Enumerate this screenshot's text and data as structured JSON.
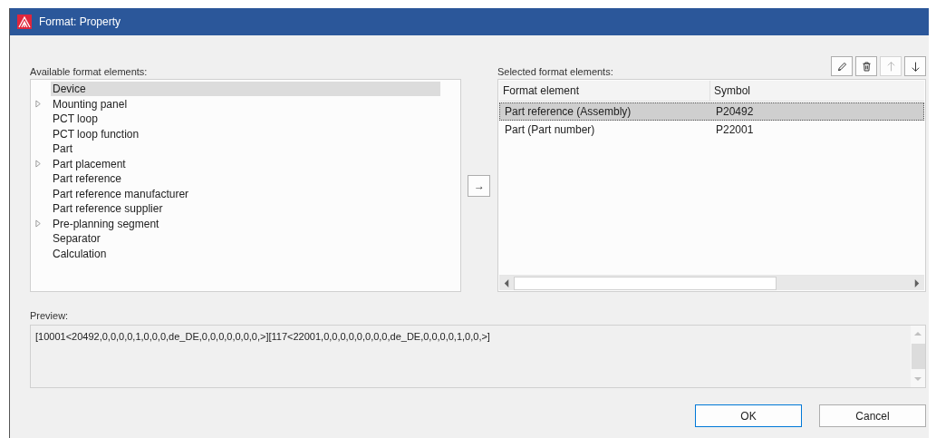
{
  "window": {
    "title": "Format: Property"
  },
  "available": {
    "label": "Available format elements:",
    "items": [
      {
        "label": "Device",
        "expandable": false,
        "selected": true
      },
      {
        "label": "Mounting panel",
        "expandable": true,
        "selected": false
      },
      {
        "label": "PCT loop",
        "expandable": false,
        "selected": false
      },
      {
        "label": "PCT loop function",
        "expandable": false,
        "selected": false
      },
      {
        "label": "Part",
        "expandable": false,
        "selected": false
      },
      {
        "label": "Part placement",
        "expandable": true,
        "selected": false
      },
      {
        "label": "Part reference",
        "expandable": false,
        "selected": false
      },
      {
        "label": "Part reference manufacturer",
        "expandable": false,
        "selected": false
      },
      {
        "label": "Part reference supplier",
        "expandable": false,
        "selected": false
      },
      {
        "label": "Pre-planning segment",
        "expandable": true,
        "selected": false
      },
      {
        "label": "Separator",
        "expandable": false,
        "selected": false
      },
      {
        "label": "Calculation",
        "expandable": false,
        "selected": false
      }
    ]
  },
  "add_button": {
    "label": "→"
  },
  "selected": {
    "label": "Selected format elements:",
    "toolbar": [
      {
        "kind": "edit",
        "disabled": false
      },
      {
        "kind": "delete",
        "disabled": false
      },
      {
        "kind": "up",
        "disabled": true
      },
      {
        "kind": "down",
        "disabled": false
      }
    ],
    "columns": [
      "Format element",
      "Symbol"
    ],
    "rows": [
      {
        "cells": [
          "Part reference (Assembly)",
          "P20492"
        ],
        "selected": true
      },
      {
        "cells": [
          "Part (Part number)",
          "P22001"
        ],
        "selected": false
      }
    ]
  },
  "preview": {
    "label": "Preview:",
    "value": "[10001<20492,0,0,0,0,1,0,0,0,de_DE,0,0,0,0,0,0,0,>][117<22001,0,0,0,0,0,0,0,0,de_DE,0,0,0,0,1,0,0,>]"
  },
  "buttons": [
    {
      "label": "OK",
      "default": true
    },
    {
      "label": "Cancel",
      "default": false
    }
  ]
}
